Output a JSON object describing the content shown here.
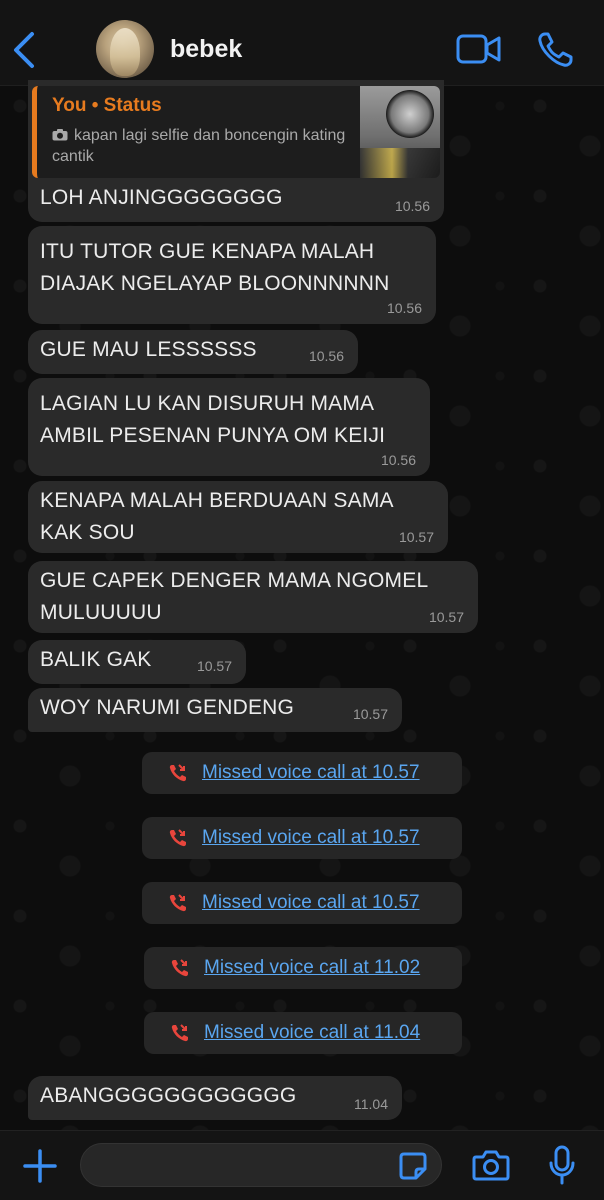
{
  "header": {
    "contact_name": "bebek",
    "icons": [
      "chevron-left-icon",
      "avatar",
      "video-camera-icon",
      "phone-icon"
    ],
    "accent_color": "#3b8ef3"
  },
  "reply": {
    "author": "You • Status",
    "quoted_text": "kapan lagi selfie dan boncengin kating cantik",
    "message": "LOH ANJINGGGGGGGG",
    "time": "10.56",
    "quote_color": "#e77b1f"
  },
  "messages": [
    {
      "text": "ITU TUTOR GUE KENAPA MALAH\nDIAJAK NGELAYAP BLOONNNNNN",
      "time": "10.56"
    },
    {
      "text": "GUE MAU LESSSSSS",
      "time": "10.56"
    },
    {
      "text": "LAGIAN LU KAN DISURUH MAMA\nAMBIL PESENAN PUNYA OM KEIJI",
      "time": "10.56"
    },
    {
      "text": "KENAPA MALAH BERDUAAN SAMA\nKAK SOU",
      "time": "10.57"
    },
    {
      "text": "GUE CAPEK DENGER MAMA NGOMEL\nMULUUUUU",
      "time": "10.57"
    },
    {
      "text": "BALIK GAK",
      "time": "10.57"
    },
    {
      "text": "WOY NARUMI GENDENG",
      "time": "10.57"
    },
    {
      "text": "ABANGGGGGGGGGGGG",
      "time": "11.04"
    }
  ],
  "missed_calls": [
    {
      "text": "Missed voice call at 10.57"
    },
    {
      "text": "Missed voice call at 10.57"
    },
    {
      "text": "Missed voice call at 10.57"
    },
    {
      "text": "Missed voice call at 11.02"
    },
    {
      "text": "Missed voice call at 11.04"
    }
  ],
  "input_bar": {
    "icons": [
      "plus-icon",
      "sticker-icon",
      "camera-icon",
      "microphone-icon"
    ]
  },
  "colors": {
    "bubble": "#2a2a2a",
    "missed_call_link": "#5aa6f0",
    "missed_call_icon": "#e8453c"
  }
}
